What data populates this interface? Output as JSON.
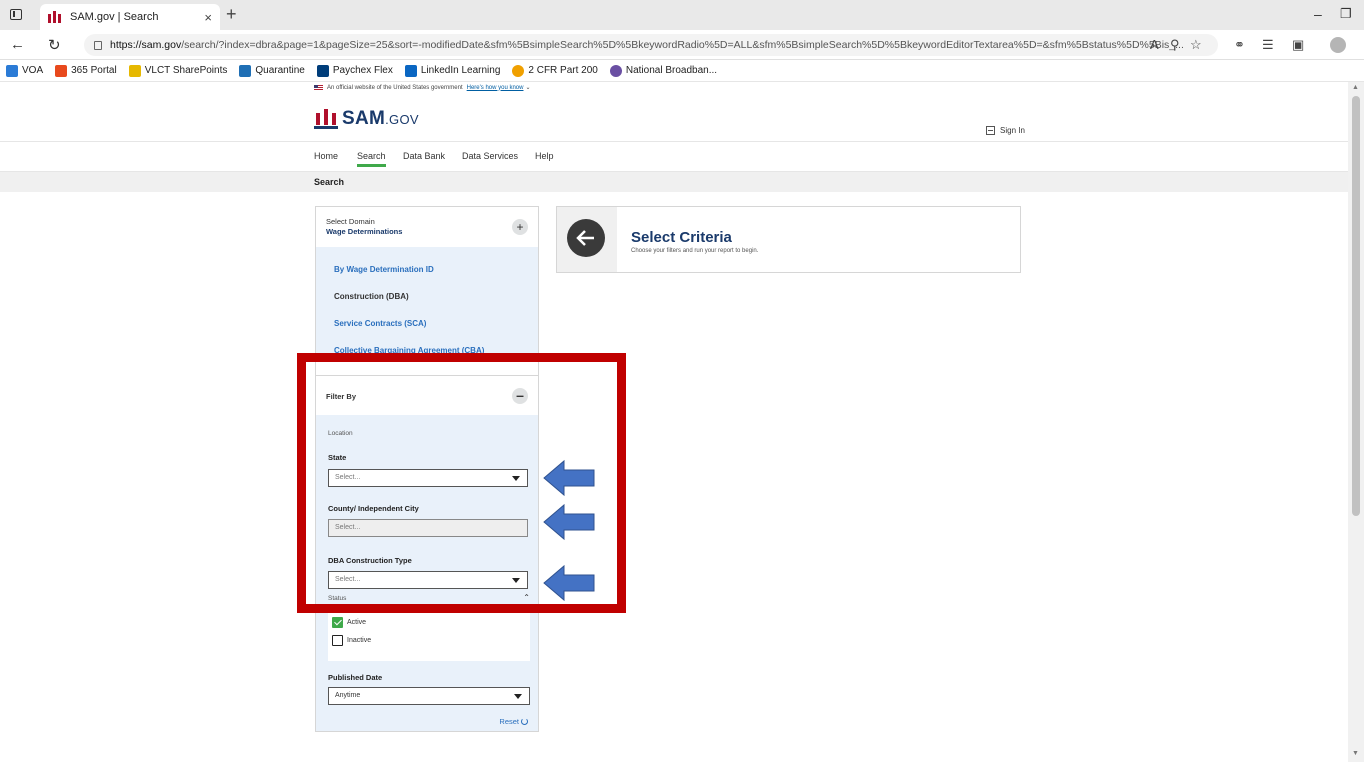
{
  "browser": {
    "tab_title": "SAM.gov | Search",
    "tab_close": "×",
    "new_tab": "+",
    "url_host": "https://sam.gov",
    "url_path": "/search/?index=dbra&page=1&pageSize=25&sort=-modifiedDate&sfm%5BsimpleSearch%5D%5BkeywordRadio%5D=ALL&sfm%5BsimpleSearch%5D%5BkeywordEditorTextarea%5D=&sfm%5Bstatus%5D%5Bis_...",
    "read_aloud": "A",
    "bookmarks": [
      {
        "label": "VOA",
        "color": "#2b7bd6"
      },
      {
        "label": "365 Portal",
        "color": "#e8491d"
      },
      {
        "label": "VLCT SharePoints",
        "color": "#e6b800"
      },
      {
        "label": "Quarantine",
        "color": "#1f6fb5"
      },
      {
        "label": "Paychex Flex",
        "color": "#003d7a"
      },
      {
        "label": "LinkedIn Learning",
        "color": "#0a66c2"
      },
      {
        "label": "2 CFR Part 200",
        "color": "#f0a000"
      },
      {
        "label": "National Broadban...",
        "color": "#6a4fa3"
      }
    ]
  },
  "site": {
    "gov_banner": "An official website of the United States government",
    "gov_banner_link": "Here's how you know",
    "logo_main": "SAM",
    "logo_suffix": ".GOV",
    "sign_in": "Sign In",
    "nav": [
      "Home",
      "Search",
      "Data Bank",
      "Data Services",
      "Help"
    ],
    "active_nav": "Search",
    "page_title": "Search"
  },
  "sidebar": {
    "domain_label": "Select Domain",
    "domain_value": "Wage Determinations",
    "domain_items": [
      "By Wage Determination ID",
      "Construction (DBA)",
      "Service Contracts (SCA)",
      "Collective Bargaining Agreement (CBA)"
    ],
    "filter_by": "Filter By",
    "location": "Location",
    "state_label": "State",
    "state_placeholder": "Select...",
    "county_label": "County/ Independent City",
    "county_placeholder": "Select...",
    "dba_label": "DBA Construction Type",
    "dba_placeholder": "Select...",
    "status_label": "Status",
    "status_options": [
      {
        "label": "Active",
        "checked": true
      },
      {
        "label": "Inactive",
        "checked": false
      }
    ],
    "published_label": "Published Date",
    "published_value": "Anytime",
    "reset": "Reset"
  },
  "criteria": {
    "title": "Select Criteria",
    "subtitle": "Choose your filters and run your report to begin."
  },
  "colors": {
    "sam_red": "#b0102c",
    "sam_navy": "#1a3a6b",
    "link_blue": "#2a6fbd",
    "active_green": "#3fa94a",
    "highlight_red": "#c00000",
    "arrow_blue": "#4472c4"
  }
}
